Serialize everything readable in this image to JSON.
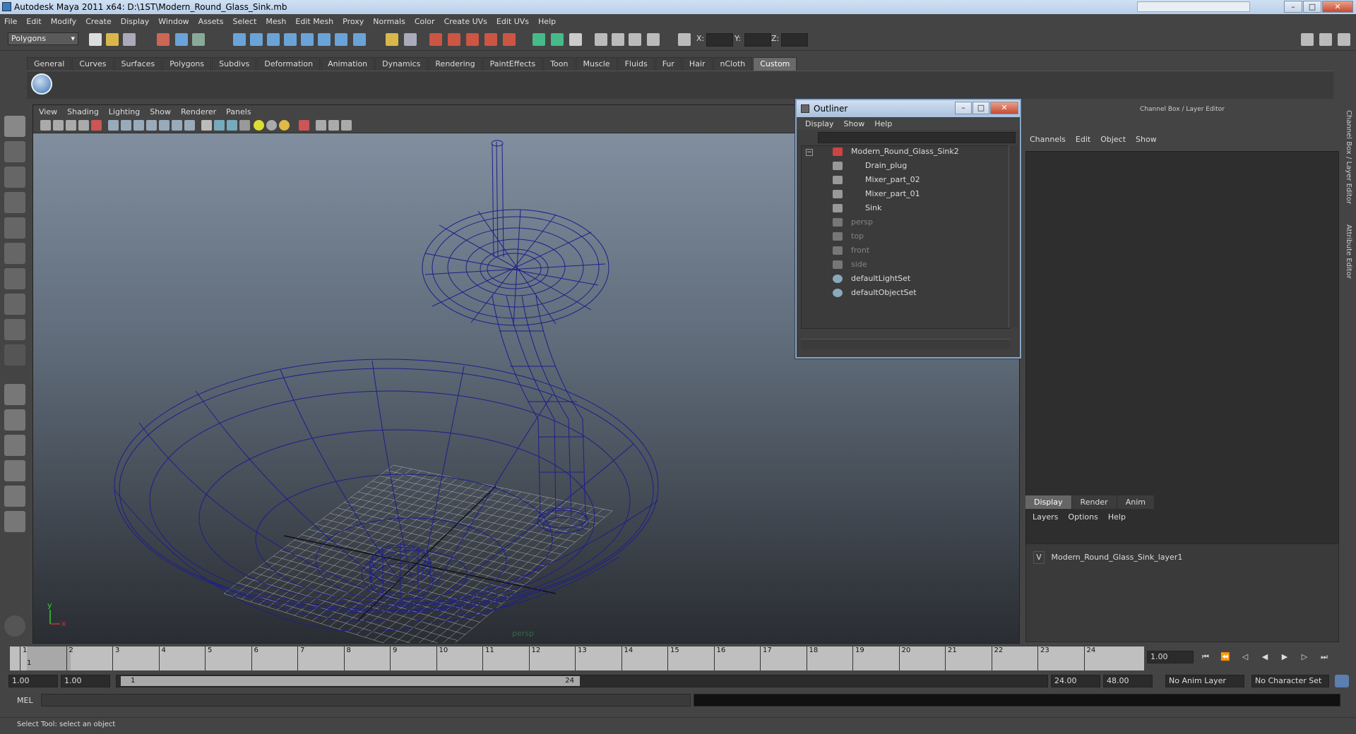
{
  "window": {
    "title": "Autodesk Maya 2011 x64: D:\\1ST\\Modern_Round_Glass_Sink.mb",
    "min": "–",
    "max": "□",
    "close": "✕"
  },
  "menubar": [
    "File",
    "Edit",
    "Modify",
    "Create",
    "Display",
    "Window",
    "Assets",
    "Select",
    "Mesh",
    "Edit Mesh",
    "Proxy",
    "Normals",
    "Color",
    "Create UVs",
    "Edit UVs",
    "Help"
  ],
  "toolbar": {
    "mode": "Polygons",
    "x_label": "X:",
    "y_label": "Y:",
    "z_label": "Z:"
  },
  "shelf": {
    "tabs": [
      "General",
      "Curves",
      "Surfaces",
      "Polygons",
      "Subdivs",
      "Deformation",
      "Animation",
      "Dynamics",
      "Rendering",
      "PaintEffects",
      "Toon",
      "Muscle",
      "Fluids",
      "Fur",
      "Hair",
      "nCloth",
      "Custom"
    ],
    "active_tab": "Custom"
  },
  "viewport": {
    "menu": [
      "View",
      "Shading",
      "Lighting",
      "Show",
      "Renderer",
      "Panels"
    ],
    "camera": "persp",
    "axis_y": "y",
    "axis_x": "x"
  },
  "outliner": {
    "title": "Outliner",
    "menu": [
      "Display",
      "Show",
      "Help"
    ],
    "items": [
      {
        "label": "Modern_Round_Glass_Sink2",
        "dim": false
      },
      {
        "label": "Drain_plug",
        "dim": false
      },
      {
        "label": "Mixer_part_02",
        "dim": false
      },
      {
        "label": "Mixer_part_01",
        "dim": false
      },
      {
        "label": "Sink",
        "dim": false
      },
      {
        "label": "persp",
        "dim": true
      },
      {
        "label": "top",
        "dim": true
      },
      {
        "label": "front",
        "dim": true
      },
      {
        "label": "side",
        "dim": true
      },
      {
        "label": "defaultLightSet",
        "dim": false
      },
      {
        "label": "defaultObjectSet",
        "dim": false
      }
    ]
  },
  "channel_box": {
    "title": "Channel Box / Layer Editor",
    "menu": [
      "Channels",
      "Edit",
      "Object",
      "Show"
    ],
    "layer_tabs": [
      "Display",
      "Render",
      "Anim"
    ],
    "layer_menu": [
      "Layers",
      "Options",
      "Help"
    ],
    "layer": {
      "visible": "V",
      "name": "Modern_Round_Glass_Sink_layer1"
    },
    "side_tabs": [
      "Channel Box / Layer Editor",
      "Attribute Editor"
    ]
  },
  "timeline": {
    "ticks": [
      "1",
      "2",
      "3",
      "4",
      "5",
      "6",
      "7",
      "8",
      "9",
      "10",
      "11",
      "12",
      "13",
      "14",
      "15",
      "16",
      "17",
      "18",
      "19",
      "20",
      "21",
      "22",
      "23",
      "24"
    ],
    "current_frame": "1",
    "current_time": "1.00"
  },
  "range": {
    "start": "1.00",
    "playback_start": "1.00",
    "slider_start": "1",
    "slider_end": "24",
    "playback_end": "24.00",
    "end": "48.00",
    "anim_layer": "No Anim Layer",
    "char_set": "No Character Set"
  },
  "command_line": {
    "label": "MEL"
  },
  "help_line": {
    "text": "Select Tool: select an object"
  },
  "colors": {
    "wire": "#1d1f8a",
    "grid": "#c8c8c8",
    "bg_top": "#8593a4",
    "bg_bottom": "#2a2d32"
  }
}
